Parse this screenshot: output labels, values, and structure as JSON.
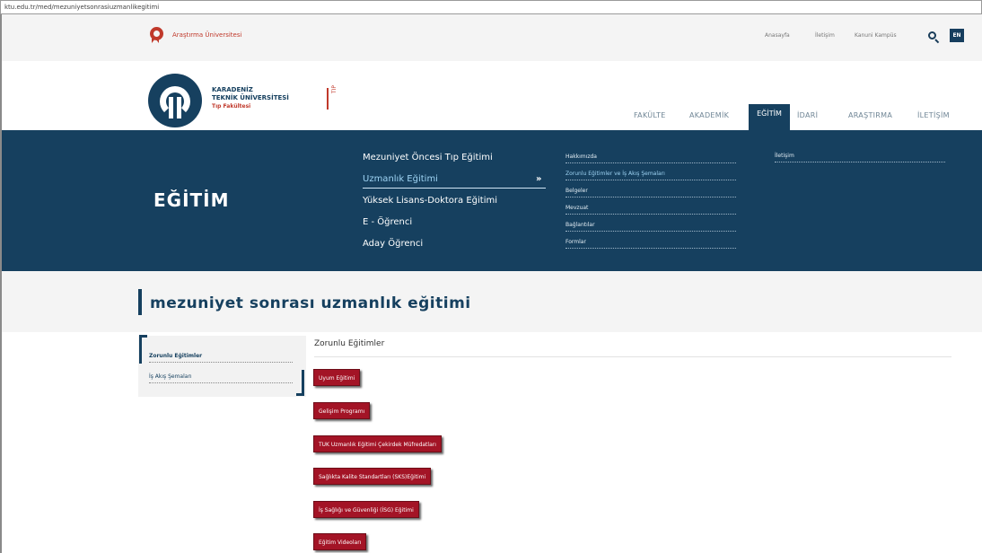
{
  "browser": {
    "url": "ktu.edu.tr/med/mezuniyetsonrasiuzmanlikegitimi"
  },
  "topbar": {
    "title": "Araştırma Üniversitesi",
    "links": [
      "Anasayfa",
      "İletişim",
      "Kanuni Kampüs"
    ],
    "lang": "EN"
  },
  "header": {
    "uni_line1": "KARADENİZ",
    "uni_line2": "TEKNİK ÜNİVERSİTESİ",
    "faculty": "Tıp Fakültesi",
    "mark": "TIP",
    "nav": [
      "FAKÜLTE",
      "AKADEMİK",
      "EĞİTİM",
      "İDARİ",
      "ARAŞTIRMA",
      "İLETİŞİM"
    ],
    "active_nav": "EĞİTİM"
  },
  "band": {
    "title": "EĞİTİM",
    "sections": [
      "Mezuniyet Öncesi Tıp Eğitimi",
      "Uzmanlık Eğitimi",
      "Yüksek Lisans-Doktora Eğitimi",
      "E - Öğrenci",
      "Aday Öğrenci"
    ],
    "arrow": "»",
    "sublinks": [
      "Hakkımızda",
      "Zorunlu Eğitimler ve İş Akış Şemaları",
      "Belgeler",
      "Mevzuat",
      "Bağlantılar",
      "Formlar"
    ],
    "col3": [
      "İletişim"
    ]
  },
  "page": {
    "title": "mezuniyet sonrası uzmanlık eğitimi"
  },
  "side_menu": [
    "Zorunlu Eğitimler",
    "İş Akış Şemaları"
  ],
  "content": {
    "heading": "Zorunlu Eğitimler",
    "buttons": [
      "Uyum Eğitimi",
      "Gelişim Programı",
      "TUK Uzmanlık Eğitimi Çekirdek Müfredatları",
      "Sağlıkta Kalite Standartları (SKS)Eğitimi",
      "İş Sağlığı ve Güvenliği (İSG) Eğitimi",
      "Eğitim Videoları"
    ]
  }
}
